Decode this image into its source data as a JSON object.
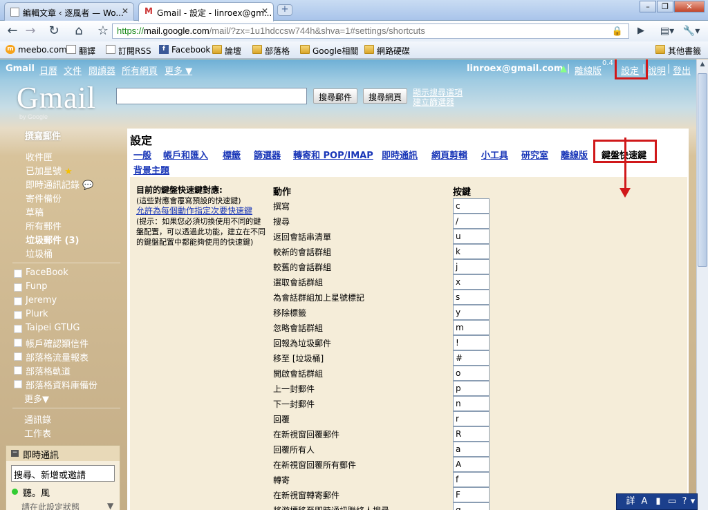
{
  "browser": {
    "tabs": [
      {
        "title": "編輯文章 ‹ 逐風者 — Wo..."
      },
      {
        "title": "Gmail - 設定 - linroex@gm..."
      }
    ],
    "new_tab_label": "+",
    "url": {
      "scheme": "https://",
      "host": "mail.google.com",
      "path": "/mail/?zx=1u1hdccsw744h&shva=1#settings/shortcuts"
    },
    "bookmarks": [
      "meebo.com",
      "翻譯",
      "訂閱RSS",
      "Facebook",
      "論壇",
      "部落格",
      "Google相關",
      "網路硬碟"
    ],
    "other_bookmarks": "其他書籤"
  },
  "gmail": {
    "topnav": {
      "brand": "Gmail",
      "links": [
        "日曆",
        "文件",
        "閱讀器",
        "所有網頁",
        "更多 ▼"
      ],
      "email": "linroex@gmail.com",
      "offline": "離線版",
      "offline_version": "0.4",
      "settings": "設定",
      "help": "說明",
      "logout": "登出",
      "sep": "|"
    },
    "logo": {
      "text": "Gmail",
      "by": "by Google"
    },
    "search": {
      "value": "",
      "mail_button": "搜尋郵件",
      "web_button": "搜尋網頁",
      "options_link": "顯示搜尋選項",
      "filter_link": "建立篩選器"
    },
    "sidebar": {
      "compose": "撰寫郵件",
      "items": [
        "收件匣",
        "已加星號",
        "即時通訊記錄",
        "寄件備份",
        "草稿",
        "所有郵件",
        "垃圾郵件 (3)",
        "垃圾桶"
      ],
      "labels": [
        "FaceBook",
        "Funp",
        "Jeremy",
        "Plurk",
        "Taipei GTUG",
        "帳戶確認類信件",
        "部落格流量報表",
        "部落格軌道",
        "部落格資料庫備份"
      ],
      "more": "更多▼",
      "contacts": "通訊錄",
      "tasks": "工作表"
    },
    "chat": {
      "title": "即時通訊",
      "input_value": "搜尋、新增或邀請",
      "user": "聽。風",
      "status": "請在此設定狀態"
    },
    "settings": {
      "title": "設定",
      "tabs": [
        "一般",
        "帳戶和匯入",
        "標籤",
        "篩選器",
        "轉寄和 POP/IMAP",
        "即時通訊",
        "網頁剪輯",
        "小工具",
        "研究室",
        "離線版",
        "鍵盤快速鍵",
        "背景主題"
      ],
      "left": {
        "heading": "目前的鍵盤快速鍵對應:",
        "sub": "(這些對應會覆寫預設的快速鍵)",
        "link": "允許為每個動作指定次要快速鍵",
        "hint": "(提示：如果您必須切換使用不同的鍵盤配置，可以透過此功能，建立在不同的鍵盤配置中都能夠使用的快速鍵)"
      },
      "col_action": "動作",
      "col_key": "按鍵",
      "shortcuts": [
        {
          "action": "撰寫",
          "key": "c"
        },
        {
          "action": "搜尋",
          "key": "/"
        },
        {
          "action": "返回會話串清單",
          "key": "u"
        },
        {
          "action": "較新的會話群組",
          "key": "k"
        },
        {
          "action": "較舊的會話群組",
          "key": "j"
        },
        {
          "action": "選取會話群組",
          "key": "x"
        },
        {
          "action": "為會話群組加上星號標記",
          "key": "s"
        },
        {
          "action": "移除標籤",
          "key": "y"
        },
        {
          "action": "忽略會話群組",
          "key": "m"
        },
        {
          "action": "回報為垃圾郵件",
          "key": "!"
        },
        {
          "action": "移至 [垃圾桶]",
          "key": "#"
        },
        {
          "action": "開啟會話群組",
          "key": "o"
        },
        {
          "action": "上一封郵件",
          "key": "p"
        },
        {
          "action": "下一封郵件",
          "key": "n"
        },
        {
          "action": "回覆",
          "key": "r"
        },
        {
          "action": "在新視窗回覆郵件",
          "key": "R"
        },
        {
          "action": "回覆所有人",
          "key": "a"
        },
        {
          "action": "在新視窗回覆所有郵件",
          "key": "A"
        },
        {
          "action": "轉寄",
          "key": "f"
        },
        {
          "action": "在新視窗轉寄郵件",
          "key": "F"
        },
        {
          "action": "將游標移至即時通訊聯絡人搜尋",
          "key": "q"
        }
      ]
    }
  },
  "ime": [
    "詳",
    "A",
    "▮",
    "▭",
    "?",
    "▾"
  ],
  "colors": {
    "link": "#1a37b8",
    "highlight": "#d0181a",
    "content_bg": "#f5edd9"
  }
}
